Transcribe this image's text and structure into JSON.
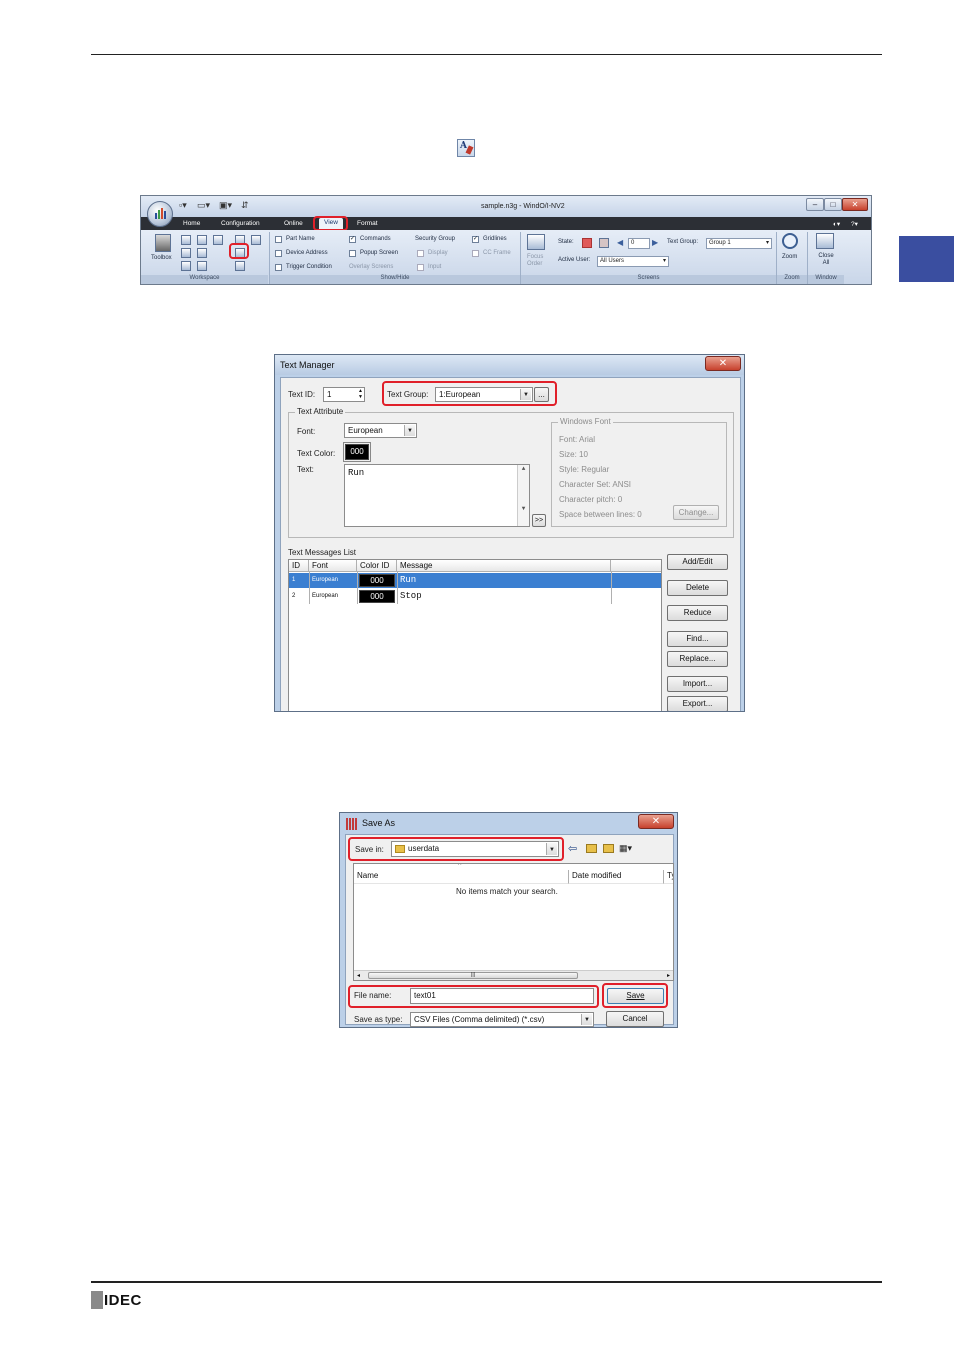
{
  "ribbon": {
    "title": "sample.n3g - WindO/I-NV2",
    "tabs": [
      "Home",
      "Configuration",
      "Online",
      "View",
      "Format"
    ],
    "active_tab": "View",
    "groups": {
      "workspace": "Workspace",
      "show_hide": "Show/Hide",
      "screens": "Screens",
      "zoom": "Zoom",
      "window": "Window"
    },
    "toolbox_label": "Toolbox",
    "show_hide": {
      "part_name": "Part Name",
      "device_address": "Device Address",
      "trigger_condition": "Trigger Condition",
      "commands": "Commands",
      "popup_screen": "Popup Screen",
      "overlay_screens": "Overlay Screens",
      "security_group": "Security Group",
      "display": "Display",
      "input": "Input",
      "gridlines": "Gridlines",
      "cc_frame": "CC Frame"
    },
    "screens": {
      "focus_order": "Focus Order",
      "state_label": "State:",
      "state_value": "0",
      "text_group_label": "Text Group:",
      "text_group_value": "Group 1",
      "active_user_label": "Active User:",
      "active_user_value": "All Users"
    },
    "zoom_label": "Zoom",
    "close_all_label": "Close All"
  },
  "text_manager": {
    "title": "Text Manager",
    "close": "✕",
    "text_id_label": "Text ID:",
    "text_id_value": "1",
    "text_group_label": "Text Group:",
    "text_group_value": "1:European",
    "browse": "...",
    "text_attribute_title": "Text Attribute",
    "font_label": "Font:",
    "font_value": "European",
    "text_color_label": "Text Color:",
    "text_color_value": "000",
    "text_label": "Text:",
    "text_value": "Run",
    "expand": ">>",
    "windows_font": {
      "title": "Windows Font",
      "font": "Font:     Arial",
      "size": "Size:     10",
      "style": "Style:     Regular",
      "charset": "Character Set:    ANSI",
      "pitch": "Character pitch:    0",
      "spacing": "Space between lines:    0",
      "change": "Change..."
    },
    "list_title": "Text Messages List",
    "columns": [
      "ID",
      "Font",
      "Color ID",
      "Message"
    ],
    "rows": [
      {
        "id": "1",
        "font": "European",
        "color": "000",
        "message": "Run"
      },
      {
        "id": "2",
        "font": "European",
        "color": "000",
        "message": "Stop"
      }
    ],
    "buttons": {
      "add_edit": "Add/Edit",
      "delete": "Delete",
      "reduce": "Reduce",
      "find": "Find...",
      "replace": "Replace...",
      "import": "Import...",
      "export": "Export..."
    }
  },
  "save_as": {
    "title": "Save As",
    "close": "✕",
    "save_in_label": "Save in:",
    "save_in_value": "userdata",
    "col_name": "Name",
    "col_date": "Date modified",
    "col_type": "Ty",
    "empty_message": "No items match your search.",
    "file_name_label": "File name:",
    "file_name_value": "text01",
    "save_type_label": "Save as type:",
    "save_type_value": "CSV Files (Comma delimited) (*.csv)",
    "save_button": "Save",
    "cancel_button": "Cancel"
  },
  "footer": {
    "logo": "IDEC"
  },
  "colors": {
    "accent_tab": "#3a4ea0",
    "highlight": "#e0202a",
    "selection": "#3b7fd1"
  }
}
